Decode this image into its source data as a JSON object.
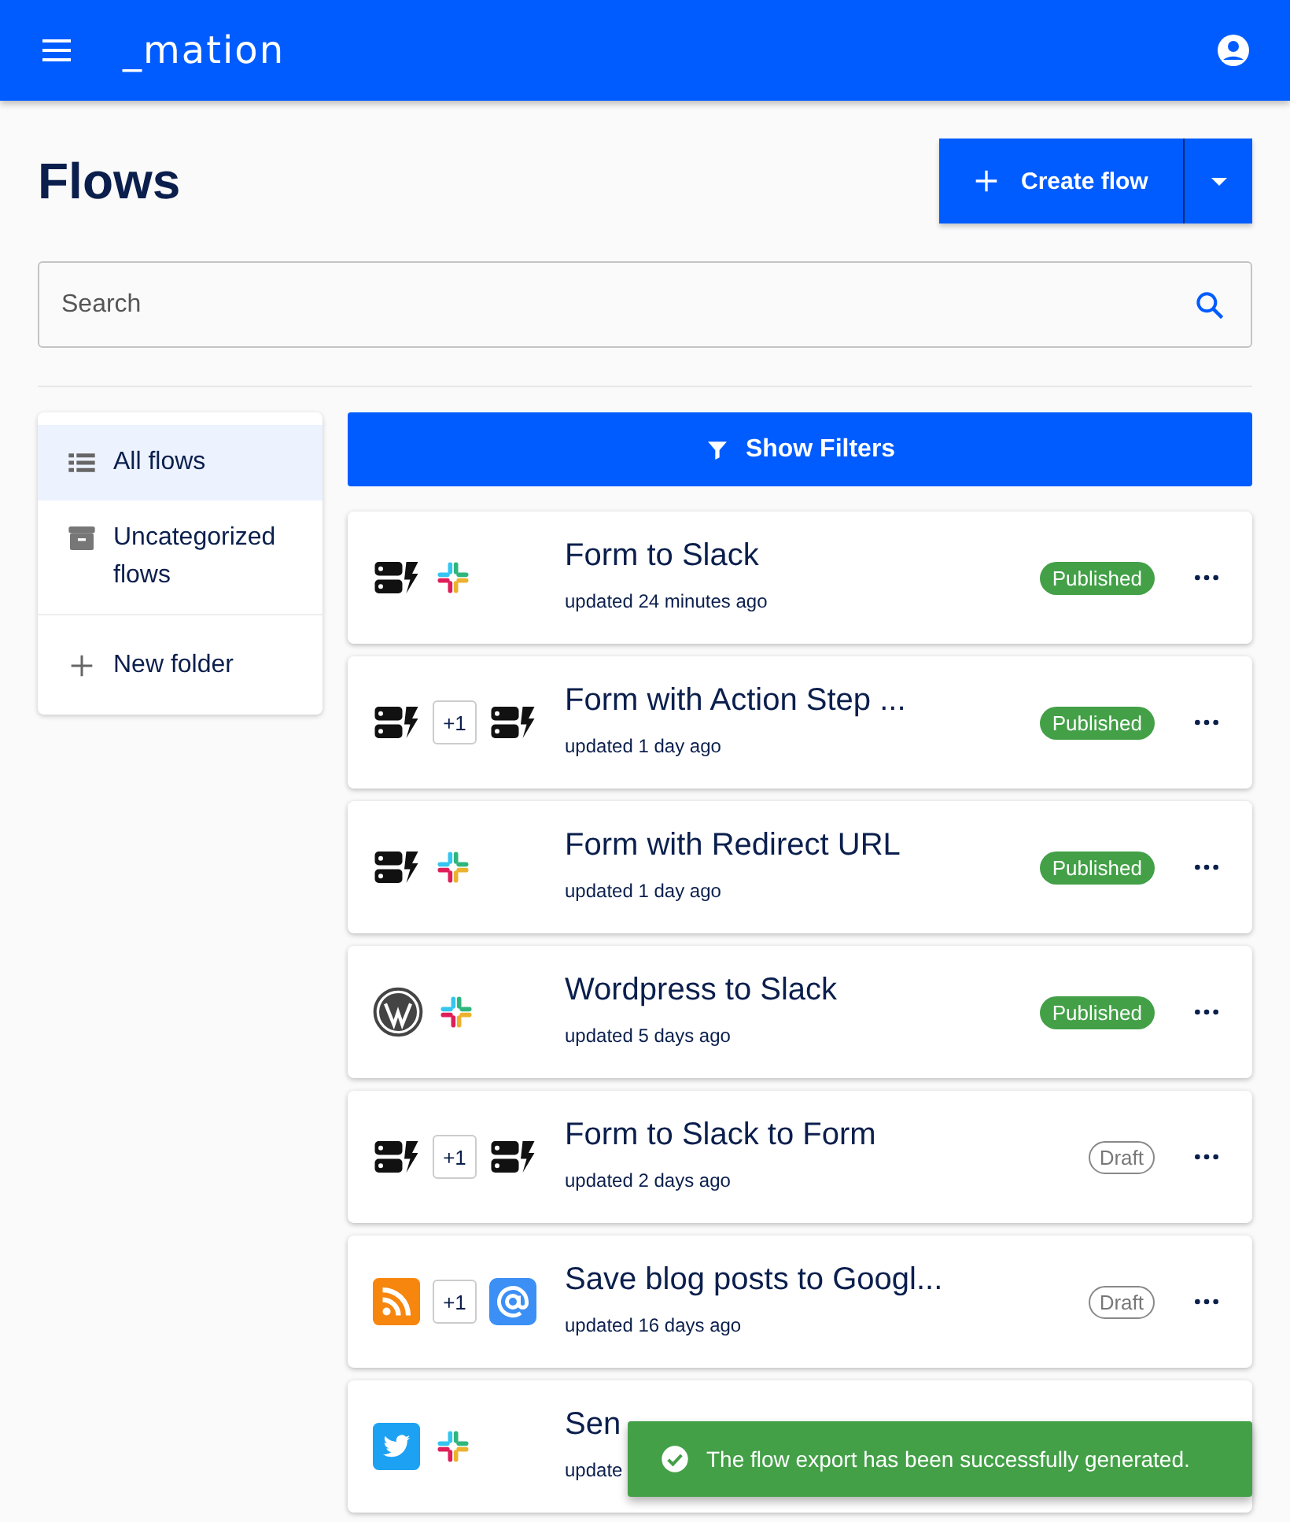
{
  "header": {
    "logo": "_mation"
  },
  "page": {
    "title": "Flows",
    "create_button": "Create flow"
  },
  "search": {
    "placeholder": "Search"
  },
  "sidebar": {
    "items": [
      {
        "kind": "list",
        "label": "All flows",
        "selected": true
      },
      {
        "kind": "archive",
        "label": "Uncategorized flows",
        "selected": false
      },
      {
        "kind": "add",
        "label": "New folder",
        "selected": false
      }
    ]
  },
  "filters_button": "Show Filters",
  "flows": [
    {
      "title": "Form to Slack",
      "updated": "updated 24 minutes ago",
      "status": "Published",
      "published": true,
      "apps": [
        {
          "kind": "form"
        },
        {
          "kind": "slack"
        }
      ]
    },
    {
      "title": "Form with Action Step ...",
      "updated": "updated 1 day ago",
      "status": "Published",
      "published": true,
      "apps": [
        {
          "kind": "form"
        },
        {
          "kind": "count",
          "label": "+1"
        },
        {
          "kind": "form"
        }
      ]
    },
    {
      "title": "Form with Redirect URL",
      "updated": "updated 1 day ago",
      "status": "Published",
      "published": true,
      "apps": [
        {
          "kind": "form"
        },
        {
          "kind": "slack"
        }
      ]
    },
    {
      "title": "Wordpress to Slack",
      "updated": "updated 5 days ago",
      "status": "Published",
      "published": true,
      "apps": [
        {
          "kind": "wordpress"
        },
        {
          "kind": "slack"
        }
      ]
    },
    {
      "title": "Form to Slack to Form",
      "updated": "updated 2 days ago",
      "status": "Draft",
      "published": false,
      "apps": [
        {
          "kind": "form"
        },
        {
          "kind": "count",
          "label": "+1"
        },
        {
          "kind": "form"
        }
      ]
    },
    {
      "title": "Save blog posts to Googl...",
      "updated": "updated 16 days ago",
      "status": "Draft",
      "published": false,
      "apps": [
        {
          "kind": "rss"
        },
        {
          "kind": "count",
          "label": "+1"
        },
        {
          "kind": "email"
        }
      ]
    },
    {
      "title": "Sen",
      "updated": "update",
      "apps": [
        {
          "kind": "twitter"
        },
        {
          "kind": "slack"
        }
      ]
    }
  ],
  "toast": {
    "message": "The flow export has been successfully generated."
  }
}
